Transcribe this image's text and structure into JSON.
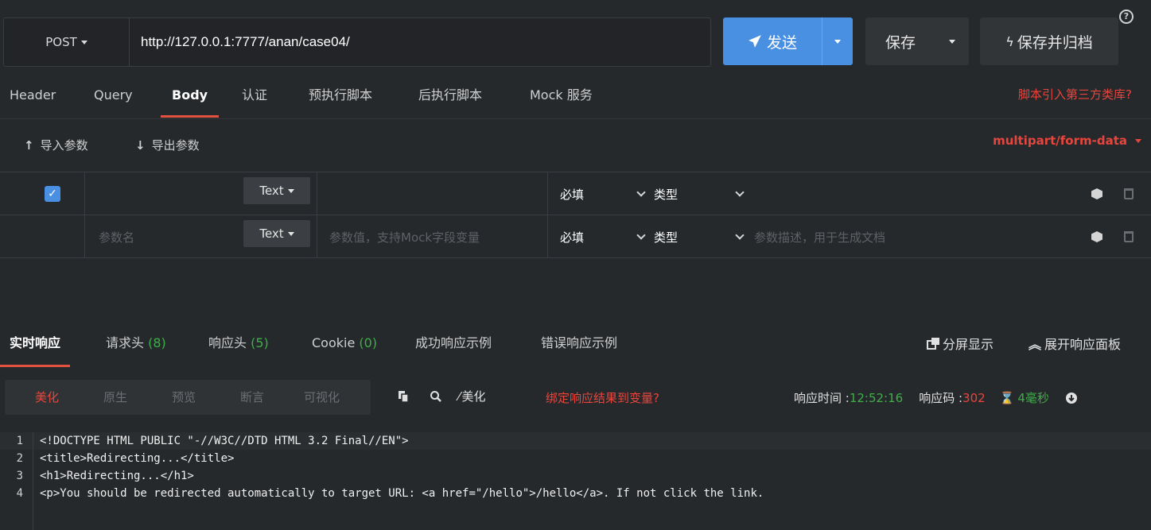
{
  "request": {
    "method": "POST",
    "url": "http://127.0.0.1:7777/anan/case04/",
    "send_label": "发送",
    "save_label": "保存",
    "save_archive_label": "保存并归档",
    "help_icon": "?"
  },
  "request_tabs": [
    "Header",
    "Query",
    "Body",
    "认证",
    "预执行脚本",
    "后执行脚本",
    "Mock 服务"
  ],
  "active_request_tab": "Body",
  "third_party_link": "脚本引入第三方类库?",
  "body_toolbar": {
    "import_label": "导入参数",
    "export_label": "导出参数",
    "content_type": "multipart/form-data"
  },
  "params": [
    {
      "checked": true,
      "name": "",
      "name_placeholder": "",
      "type": "Text",
      "value": "",
      "value_placeholder": "",
      "required": "必填",
      "field_type": "类型",
      "desc_placeholder": ""
    },
    {
      "checked": false,
      "name": "",
      "name_placeholder": "参数名",
      "type": "Text",
      "value": "",
      "value_placeholder": "参数值，支持Mock字段变量",
      "required": "必填",
      "field_type": "类型",
      "desc_placeholder": "参数描述，用于生成文档"
    }
  ],
  "response_tabs": {
    "realtime": "实时响应",
    "req_headers": "请求头",
    "req_headers_count": "(8)",
    "resp_headers": "响应头",
    "resp_headers_count": "(5)",
    "cookie": "Cookie",
    "cookie_count": "(0)",
    "success_example": "成功响应示例",
    "error_example": "错误响应示例",
    "split_view": "分屏显示",
    "expand_panel": "展开响应面板"
  },
  "view_modes": [
    "美化",
    "原生",
    "预览",
    "断言",
    "可视化"
  ],
  "active_view_mode": "美化",
  "tools": {
    "beautify": "美化",
    "bind_var": "绑定响应结果到变量?"
  },
  "meta": {
    "time_label": "响应时间 : ",
    "time_value": "12:52:16",
    "code_label": "响应码 : ",
    "code_value": "302",
    "duration": "4毫秒"
  },
  "code_lines": [
    "<!DOCTYPE HTML PUBLIC \"-//W3C//DTD HTML 3.2 Final//EN\">",
    "<title>Redirecting...</title>",
    "<h1>Redirecting...</h1>",
    "<p>You should be redirected automatically to target URL: <a href=\"/hello\">/hello</a>. If not click the link."
  ],
  "colors": {
    "accent": "#4a90e2",
    "danger": "#e8453c",
    "success": "#3fae49",
    "background": "#26292c"
  }
}
